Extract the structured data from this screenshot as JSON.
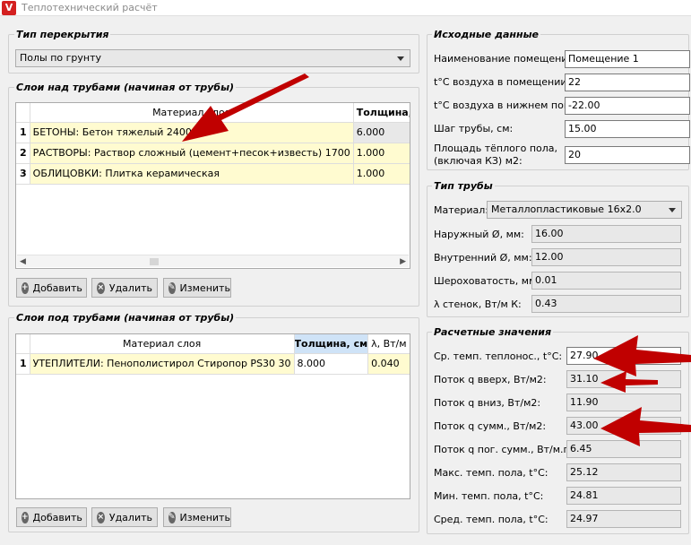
{
  "window": {
    "title": "Теплотехнический расчёт",
    "icon_letter": "V"
  },
  "floor_type": {
    "title": "Тип перекрытия",
    "selected": "Полы по грунту"
  },
  "above": {
    "title": "Слои над трубами (начиная от трубы)",
    "columns": [
      "Материал слоя",
      "Толщина, см"
    ],
    "rows": [
      {
        "n": "1",
        "material": "БЕТОНЫ: Бетон тяжелый 2400",
        "thickness": "6.000"
      },
      {
        "n": "2",
        "material": "РАСТВОРЫ: Раствор сложный (цемент+песок+известь) 1700",
        "thickness": "1.000"
      },
      {
        "n": "3",
        "material": "ОБЛИЦОВКИ: Плитка керамическая",
        "thickness": "1.000"
      }
    ],
    "buttons": {
      "add": "Добавить",
      "delete": "Удалить",
      "edit": "Изменить"
    }
  },
  "below": {
    "title": "Слои под трубами (начиная от трубы)",
    "columns": [
      "Материал слоя",
      "Толщина, см",
      "λ, Вт/м К"
    ],
    "rows": [
      {
        "n": "1",
        "material": "УТЕПЛИТЕЛИ: Пенополистирол Стиропор PS30 30",
        "thickness": "8.000",
        "lambda": "0.040"
      }
    ],
    "buttons": {
      "add": "Добавить",
      "delete": "Удалить",
      "edit": "Изменить"
    }
  },
  "source": {
    "title": "Исходные данные",
    "fields": [
      {
        "label": "Наименование помещение:",
        "value": "Помещение 1"
      },
      {
        "label": "t°C воздуха в помещении:",
        "value": "22"
      },
      {
        "label": "t°C воздуха в нижнем пом.:",
        "value": "-22.00"
      },
      {
        "label": "Шаг трубы, см:",
        "value": "15.00"
      },
      {
        "label": "Площадь тёплого пола,",
        "label2": "(включая КЗ) м2:",
        "value": "20"
      }
    ]
  },
  "pipe": {
    "title": "Тип трубы",
    "material_label": "Материал:",
    "material": "Металлопластиковые 16х2.0",
    "fields": [
      {
        "label": "Наружный Ø, мм:",
        "value": "16.00"
      },
      {
        "label": "Внутренний Ø, мм:",
        "value": "12.00"
      },
      {
        "label": "Шероховатость, мм:",
        "value": "0.01"
      },
      {
        "label": "λ стенок, Вт/м К:",
        "value": "0.43"
      }
    ]
  },
  "results": {
    "title": "Расчетные значения",
    "fields": [
      {
        "label": "Ср. темп. теплонос., t°C:",
        "value": "27.90"
      },
      {
        "label": "Поток q вверх, Вт/м2:",
        "value": "31.10"
      },
      {
        "label": "Поток q вниз, Вт/м2:",
        "value": "11.90"
      },
      {
        "label": "Поток q сумм., Вт/м2:",
        "value": "43.00"
      },
      {
        "label": "Поток q пог. сумм., Вт/м.п.:",
        "value": "6.45"
      },
      {
        "label": "Макс. темп. пола, t°C:",
        "value": "25.12"
      },
      {
        "label": "Мин. темп. пола, t°C:",
        "value": "24.81"
      },
      {
        "label": "Сред. темп. пола, t°C:",
        "value": "24.97"
      }
    ]
  },
  "colors": {
    "annotation_arrow": "#c00000",
    "row_highlight": "#fffbd0",
    "header_selected": "#cfe3f7"
  }
}
